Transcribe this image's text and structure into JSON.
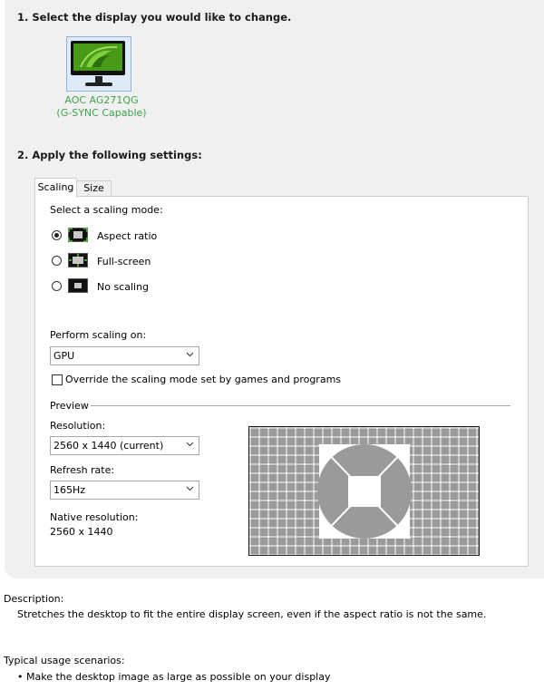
{
  "section1": {
    "heading": "1. Select the display you would like to change."
  },
  "display": {
    "name": "AOC AG271QG",
    "subtitle": "(G-SYNC Capable)",
    "icon": "monitor-icon"
  },
  "section2": {
    "heading": "2. Apply the following settings:"
  },
  "tabs": [
    {
      "label": "Scaling",
      "active": true
    },
    {
      "label": "Size",
      "active": false
    }
  ],
  "scaling": {
    "mode_label": "Select a scaling mode:",
    "modes": [
      {
        "label": "Aspect ratio",
        "selected": true,
        "icon": "aspect-ratio-icon"
      },
      {
        "label": "Full-screen",
        "selected": false,
        "icon": "full-screen-icon"
      },
      {
        "label": "No scaling",
        "selected": false,
        "icon": "no-scaling-icon"
      }
    ],
    "perform_label": "Perform scaling on:",
    "perform_value": "GPU",
    "override_label": "Override the scaling mode set by games and programs",
    "override_checked": false
  },
  "preview": {
    "label": "Preview",
    "resolution_label": "Resolution:",
    "resolution_value": "2560 x 1440 (current)",
    "refresh_label": "Refresh rate:",
    "refresh_value": "165Hz",
    "native_label": "Native resolution:",
    "native_value": "2560 x 1440"
  },
  "description": {
    "label": "Description:",
    "text": "Stretches the desktop to fit the entire display screen, even if the aspect ratio is not the same."
  },
  "usage": {
    "label": "Typical usage scenarios:",
    "items": [
      "Make the desktop image as large as possible on your display"
    ]
  },
  "colors": {
    "panel": "#f0f0f0",
    "accent_green": "#3fa34d",
    "nvidia_green": "#4a9a1a"
  }
}
